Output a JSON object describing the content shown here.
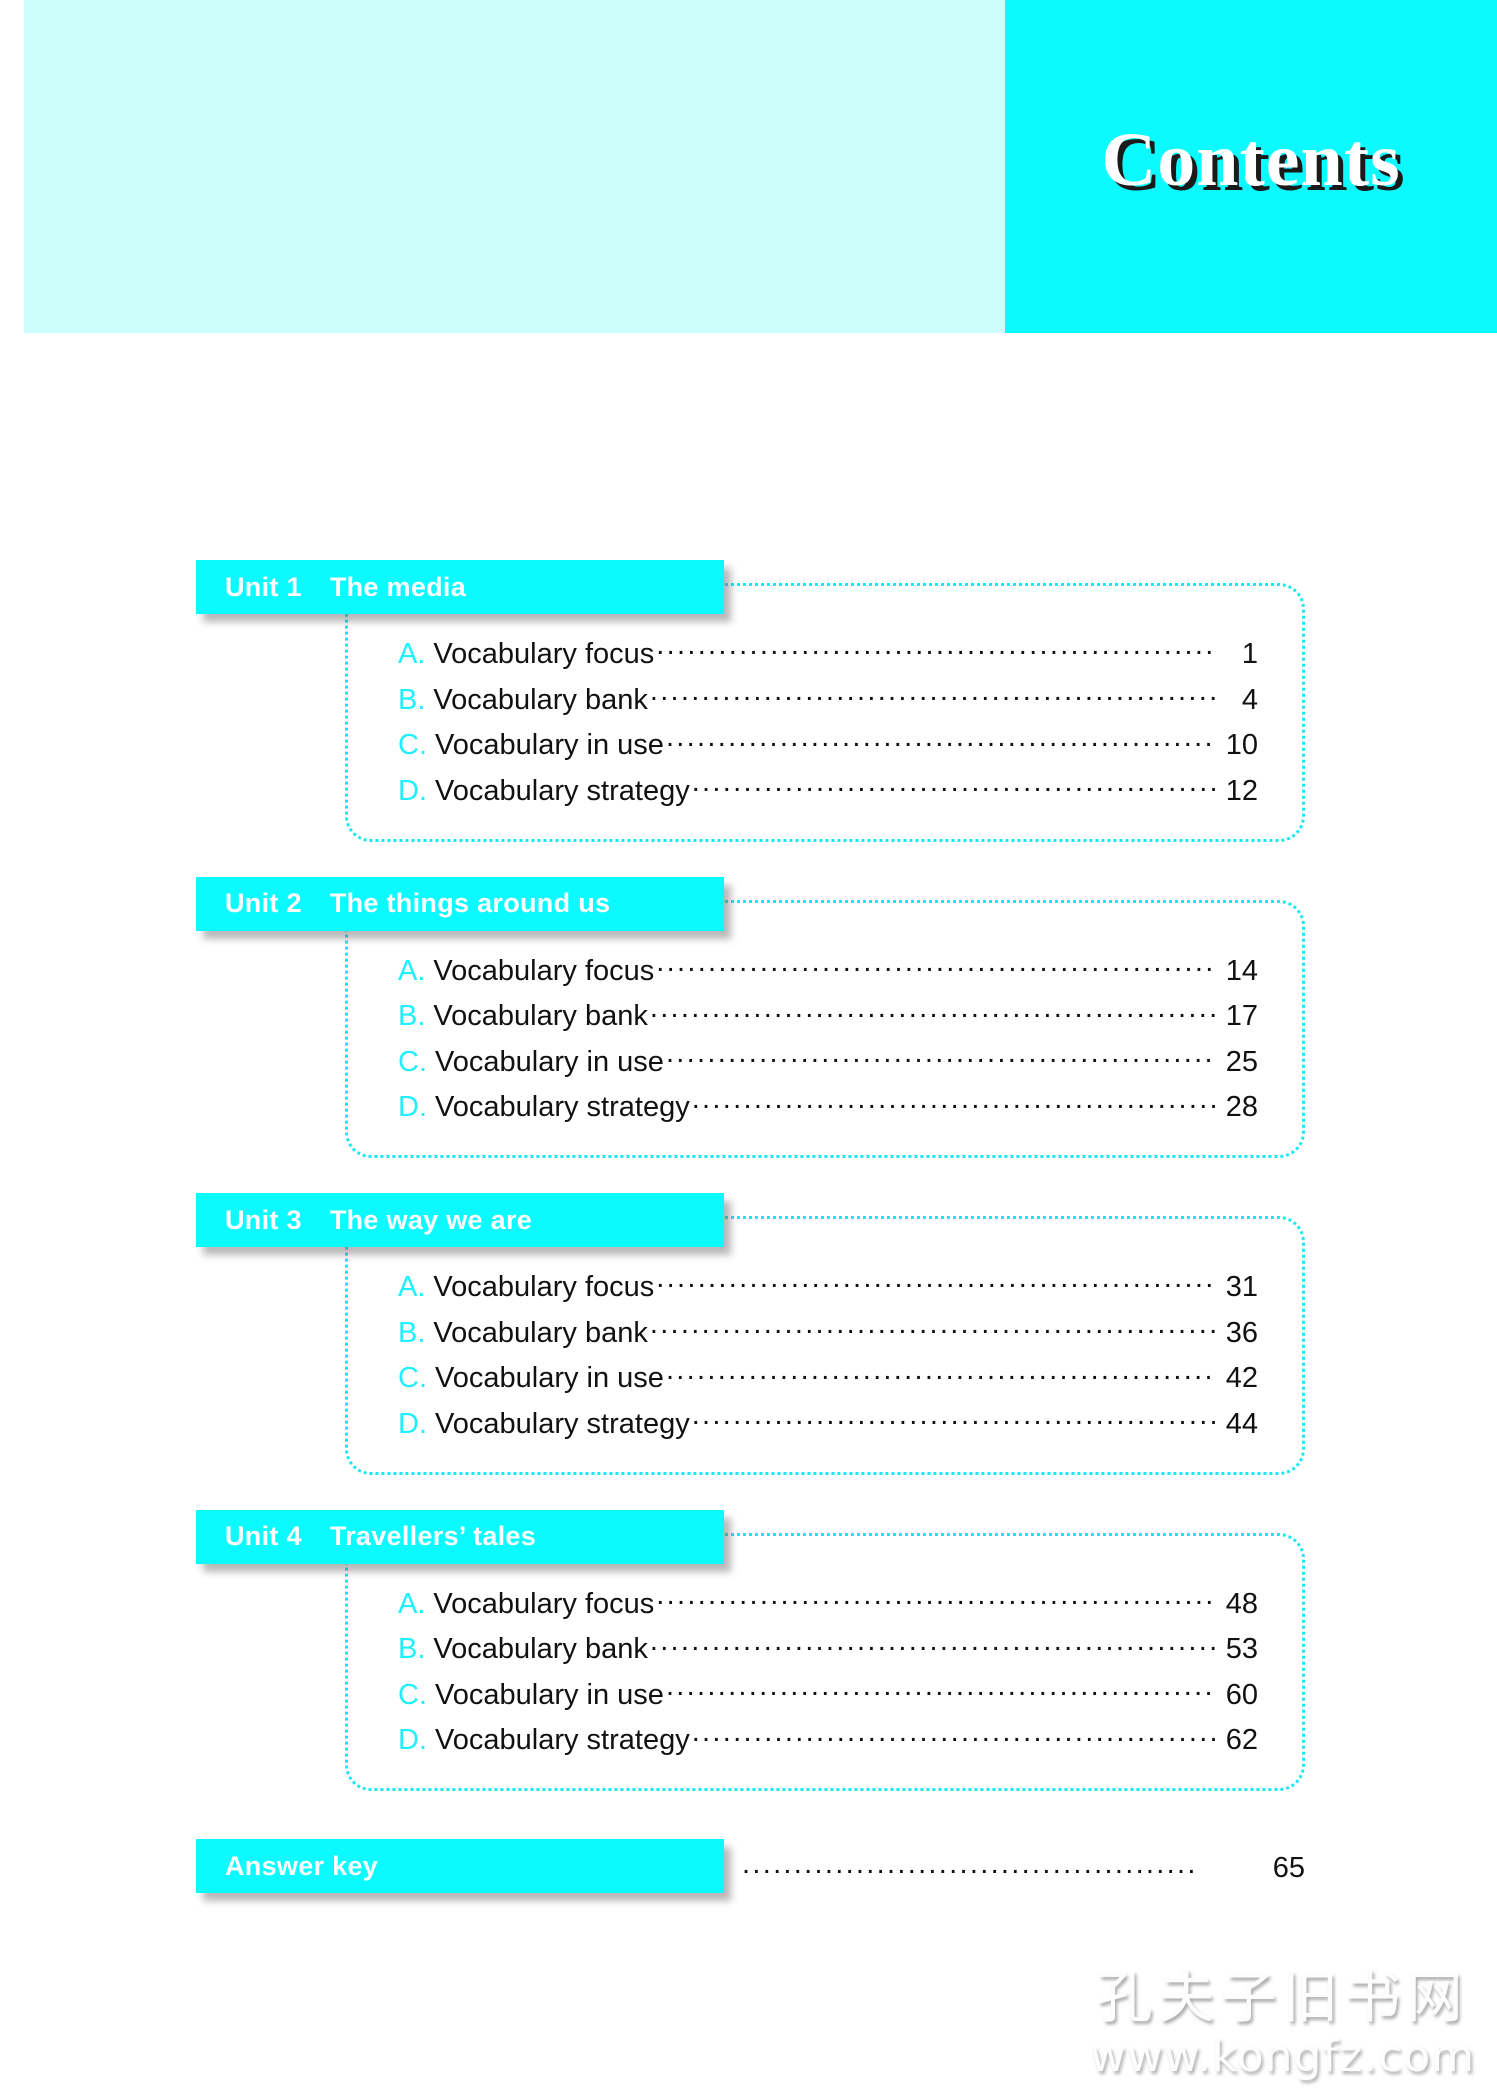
{
  "header": {
    "title": "Contents",
    "band_light_color": "#CCFFFB",
    "band_strong_color": "#0AFAFF",
    "title_color": "#FFFFFF",
    "title_shadow_color": "#1A1A1A"
  },
  "theme": {
    "accent": "#0AFAFF",
    "letter_accent": "#1FF0FF",
    "dotted_border": "#19E8F2",
    "text": "#111111"
  },
  "toc": {
    "sections": [
      {
        "unit_label": "Unit 1",
        "unit_title": "The media",
        "entries": [
          {
            "letter": "A.",
            "label": "Vocabulary focus",
            "page": "1"
          },
          {
            "letter": "B.",
            "label": "Vocabulary bank",
            "page": "4"
          },
          {
            "letter": "C.",
            "label": "Vocabulary in use",
            "page": "10"
          },
          {
            "letter": "D.",
            "label": "Vocabulary strategy",
            "page": "12"
          }
        ]
      },
      {
        "unit_label": "Unit 2",
        "unit_title": "The things around us",
        "entries": [
          {
            "letter": "A.",
            "label": "Vocabulary focus",
            "page": "14"
          },
          {
            "letter": "B.",
            "label": "Vocabulary bank",
            "page": "17"
          },
          {
            "letter": "C.",
            "label": "Vocabulary in use",
            "page": "25"
          },
          {
            "letter": "D.",
            "label": "Vocabulary strategy",
            "page": "28"
          }
        ]
      },
      {
        "unit_label": "Unit 3",
        "unit_title": "The way we are",
        "entries": [
          {
            "letter": "A.",
            "label": "Vocabulary focus",
            "page": "31"
          },
          {
            "letter": "B.",
            "label": "Vocabulary bank",
            "page": "36"
          },
          {
            "letter": "C.",
            "label": "Vocabulary in use",
            "page": "42"
          },
          {
            "letter": "D.",
            "label": "Vocabulary strategy",
            "page": "44"
          }
        ]
      },
      {
        "unit_label": "Unit 4",
        "unit_title": "Travellers’ tales",
        "entries": [
          {
            "letter": "A.",
            "label": "Vocabulary focus",
            "page": "48"
          },
          {
            "letter": "B.",
            "label": "Vocabulary bank",
            "page": "53"
          },
          {
            "letter": "C.",
            "label": "Vocabulary in use",
            "page": "60"
          },
          {
            "letter": "D.",
            "label": "Vocabulary strategy",
            "page": "62"
          }
        ]
      }
    ],
    "answer_key": {
      "label": "Answer key",
      "page": "65",
      "leader": "............................................"
    }
  },
  "watermark": {
    "chinese": "孔夫子旧书网",
    "url": "www.kongfz.com"
  }
}
